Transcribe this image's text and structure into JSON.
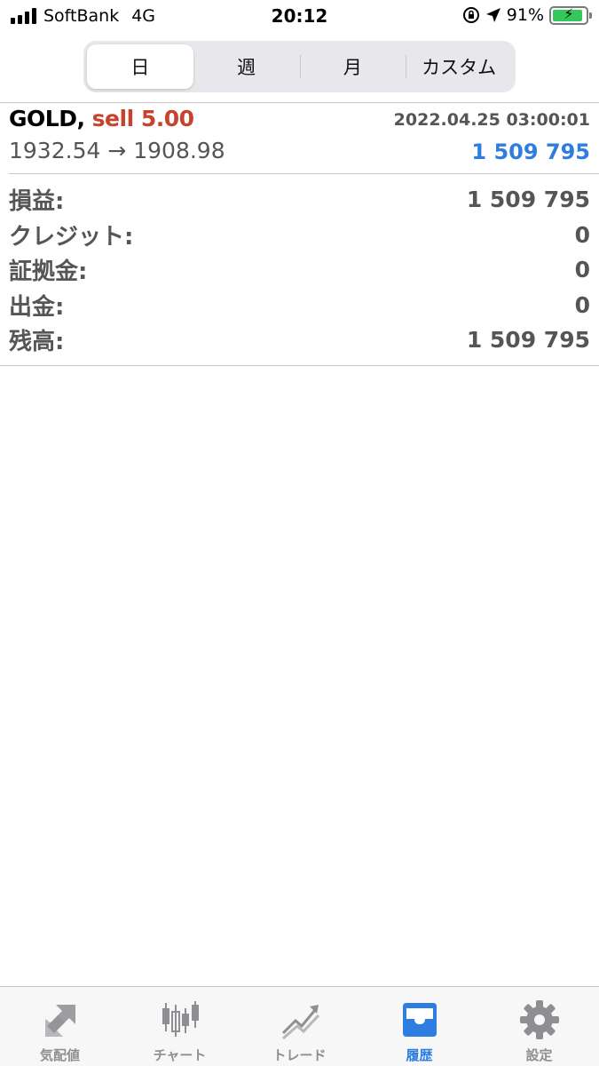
{
  "status_bar": {
    "carrier": "SoftBank",
    "network": "4G",
    "time": "20:12",
    "battery_text": "91%",
    "battery_level": 0.91
  },
  "period_tabs": [
    {
      "label": "日",
      "selected": true
    },
    {
      "label": "週",
      "selected": false
    },
    {
      "label": "月",
      "selected": false
    },
    {
      "label": "カスタム",
      "selected": false
    }
  ],
  "deal": {
    "symbol": "GOLD,",
    "side": "sell 5.00",
    "datetime": "2022.04.25 03:00:01",
    "prices": "1932.54 → 1908.98",
    "profit": "1 509 795"
  },
  "summary": [
    {
      "label": "損益:",
      "value": "1 509 795"
    },
    {
      "label": "クレジット:",
      "value": "0"
    },
    {
      "label": "証拠金:",
      "value": "0"
    },
    {
      "label": "出金:",
      "value": "0"
    },
    {
      "label": "残高:",
      "value": "1 509 795"
    }
  ],
  "tab_bar": [
    {
      "label": "気配値",
      "icon": "quotes-icon",
      "active": false
    },
    {
      "label": "チャート",
      "icon": "candlestick-chart-icon",
      "active": false
    },
    {
      "label": "トレード",
      "icon": "trade-icon",
      "active": false
    },
    {
      "label": "履歴",
      "icon": "history-tray-icon",
      "active": true
    },
    {
      "label": "設定",
      "icon": "gear-icon",
      "active": false
    }
  ],
  "colors": {
    "accent": "#2e7ee2",
    "sell": "#c8432f",
    "inactive": "#8e8e93",
    "battery": "#34c759"
  }
}
